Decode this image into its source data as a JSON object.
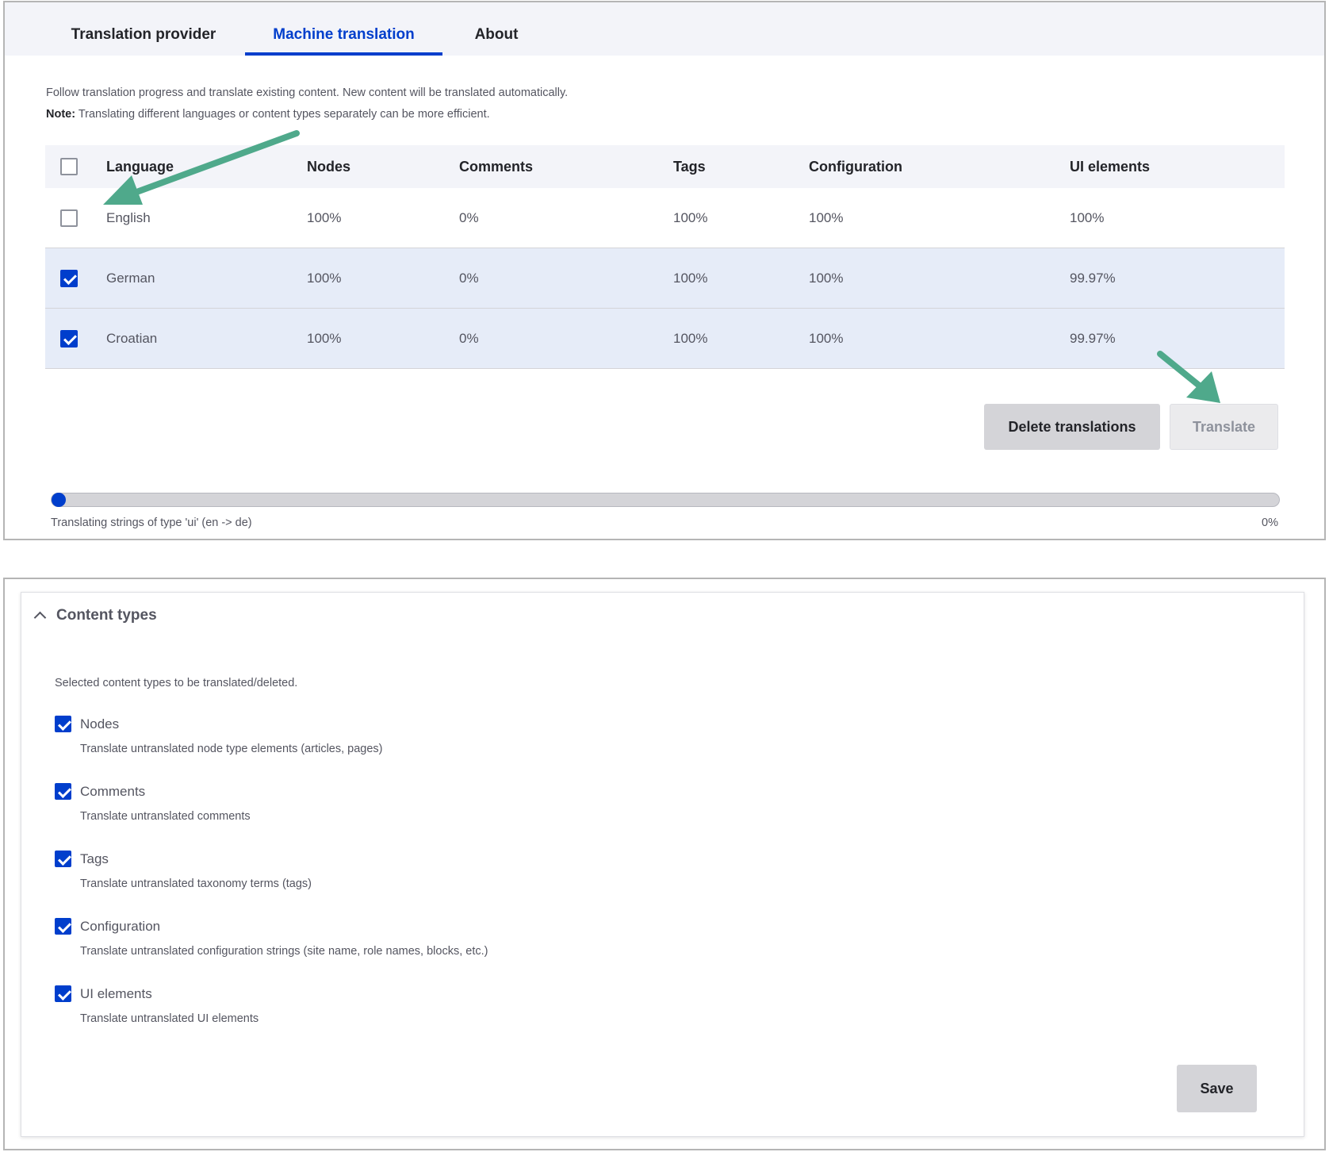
{
  "tabs": [
    {
      "label": "Translation provider",
      "active": false
    },
    {
      "label": "Machine translation",
      "active": true
    },
    {
      "label": "About",
      "active": false
    }
  ],
  "intro": "Follow translation progress and translate existing content. New content will be translated automatically.",
  "note_label": "Note:",
  "note_text": " Translating different languages or content types separately can be more efficient.",
  "table": {
    "headers": [
      "Language",
      "Nodes",
      "Comments",
      "Tags",
      "Configuration",
      "UI elements"
    ],
    "rows": [
      {
        "language": "English",
        "nodes": "100%",
        "comments": "0%",
        "tags": "100%",
        "configuration": "100%",
        "ui": "100%",
        "checked": false
      },
      {
        "language": "German",
        "nodes": "100%",
        "comments": "0%",
        "tags": "100%",
        "configuration": "100%",
        "ui": "99.97%",
        "checked": true
      },
      {
        "language": "Croatian",
        "nodes": "100%",
        "comments": "0%",
        "tags": "100%",
        "configuration": "100%",
        "ui": "99.97%",
        "checked": true
      }
    ]
  },
  "actions": {
    "delete_label": "Delete translations",
    "translate_label": "Translate"
  },
  "progress": {
    "label": "Translating strings of type 'ui' (en -> de)",
    "percent_label": "0%",
    "fraction": 0
  },
  "content_types": {
    "summary": "Content types",
    "description": "Selected content types to be translated/deleted.",
    "options": [
      {
        "label": "Nodes",
        "desc": "Translate untranslated node type elements (articles, pages)",
        "checked": true
      },
      {
        "label": "Comments",
        "desc": "Translate untranslated comments",
        "checked": true
      },
      {
        "label": "Tags",
        "desc": "Translate untranslated taxonomy terms (tags)",
        "checked": true
      },
      {
        "label": "Configuration",
        "desc": "Translate untranslated configuration strings (site name, role names, blocks, etc.)",
        "checked": true
      },
      {
        "label": "UI elements",
        "desc": "Translate untranslated UI elements",
        "checked": true
      }
    ],
    "save_label": "Save"
  },
  "colors": {
    "accent": "#003ecc",
    "annotation_arrow": "#4fa98b",
    "selected_row": "#e6ecf8"
  }
}
